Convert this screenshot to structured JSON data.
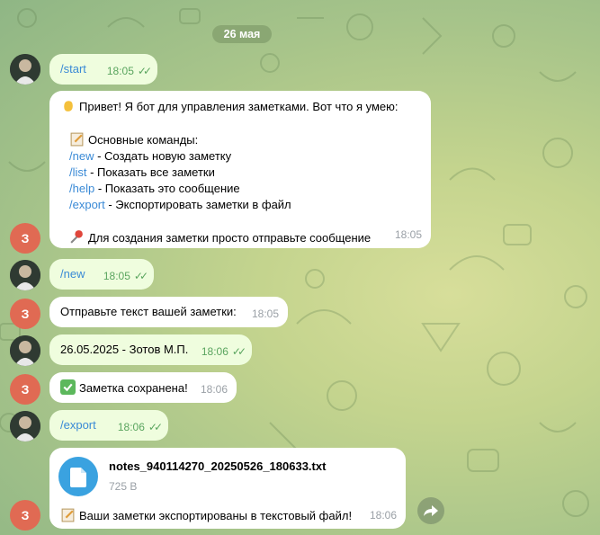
{
  "date_separator": "26 мая",
  "bot_avatar_letter": "З",
  "messages": {
    "m1": {
      "text": "/start",
      "time": "18:05"
    },
    "m2": {
      "greeting": "Привет! Я бот для управления заметками. Вот что я умею:",
      "section_title": "Основные команды:",
      "commands": [
        {
          "cmd": "/new",
          "desc": " - Создать новую заметку"
        },
        {
          "cmd": "/list",
          "desc": " - Показать все заметки"
        },
        {
          "cmd": "/help",
          "desc": " - Показать это сообщение"
        },
        {
          "cmd": "/export",
          "desc": " - Экспортировать заметки в файл"
        }
      ],
      "tip": "Для создания заметки просто отправьте сообщение",
      "time": "18:05"
    },
    "m3": {
      "text": "/new",
      "time": "18:05"
    },
    "m4": {
      "text": "Отправьте текст вашей заметки:",
      "time": "18:05"
    },
    "m5": {
      "text": "26.05.2025 - Зотов М.П.",
      "time": "18:06"
    },
    "m6": {
      "text": "Заметка сохранена!",
      "time": "18:06"
    },
    "m7": {
      "text": "/export",
      "time": "18:06"
    },
    "m8": {
      "file_name": "notes_940114270_20250526_180633.txt",
      "file_size": "725 B",
      "caption": "Ваши заметки экспортированы в текстовый файл!",
      "time": "18:06"
    }
  },
  "colors": {
    "outgoing_bubble": "#effdde",
    "incoming_bubble": "#ffffff",
    "command_link": "#3a8ad6",
    "bot_avatar": "#e06a53",
    "file_icon": "#3aa2e0",
    "date_pill": "#8aa773"
  }
}
